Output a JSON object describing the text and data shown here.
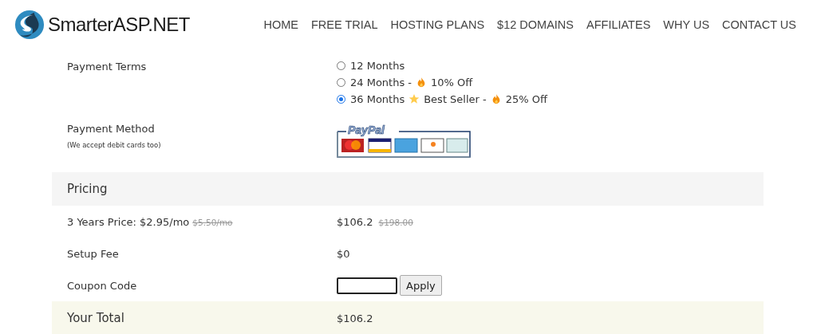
{
  "header": {
    "logo_text": "SmarterASP.NET",
    "nav": [
      "HOME",
      "FREE TRIAL",
      "HOSTING PLANS",
      "$12 DOMAINS",
      "AFFILIATES",
      "WHY US",
      "CONTACT US"
    ]
  },
  "payment_terms": {
    "label": "Payment Terms",
    "options": [
      {
        "parts": [
          {
            "kind": "text",
            "text": "12 Months"
          }
        ],
        "selected": false
      },
      {
        "parts": [
          {
            "kind": "text",
            "text": "24 Months -"
          },
          {
            "kind": "fire"
          },
          {
            "kind": "text",
            "text": "10% Off"
          }
        ],
        "selected": false
      },
      {
        "parts": [
          {
            "kind": "text",
            "text": "36 Months"
          },
          {
            "kind": "star"
          },
          {
            "kind": "text",
            "text": "Best Seller -"
          },
          {
            "kind": "fire"
          },
          {
            "kind": "text",
            "text": "25% Off"
          }
        ],
        "selected": true
      }
    ]
  },
  "payment_method": {
    "label": "Payment Method",
    "note": "(We accept debit cards too)",
    "paypal_text": "PayPal"
  },
  "pricing": {
    "heading": "Pricing",
    "rows": [
      {
        "kind": "price",
        "label": "3 Years Price: $2.95/mo",
        "label_old": "$5.50/mo",
        "value": "$106.2",
        "value_old": "$198.00"
      },
      {
        "kind": "plain",
        "label": "Setup Fee",
        "value": "$0"
      },
      {
        "kind": "coupon",
        "label": "Coupon Code",
        "button": "Apply"
      }
    ]
  },
  "total": {
    "label": "Your Total",
    "value": "$106.2"
  }
}
